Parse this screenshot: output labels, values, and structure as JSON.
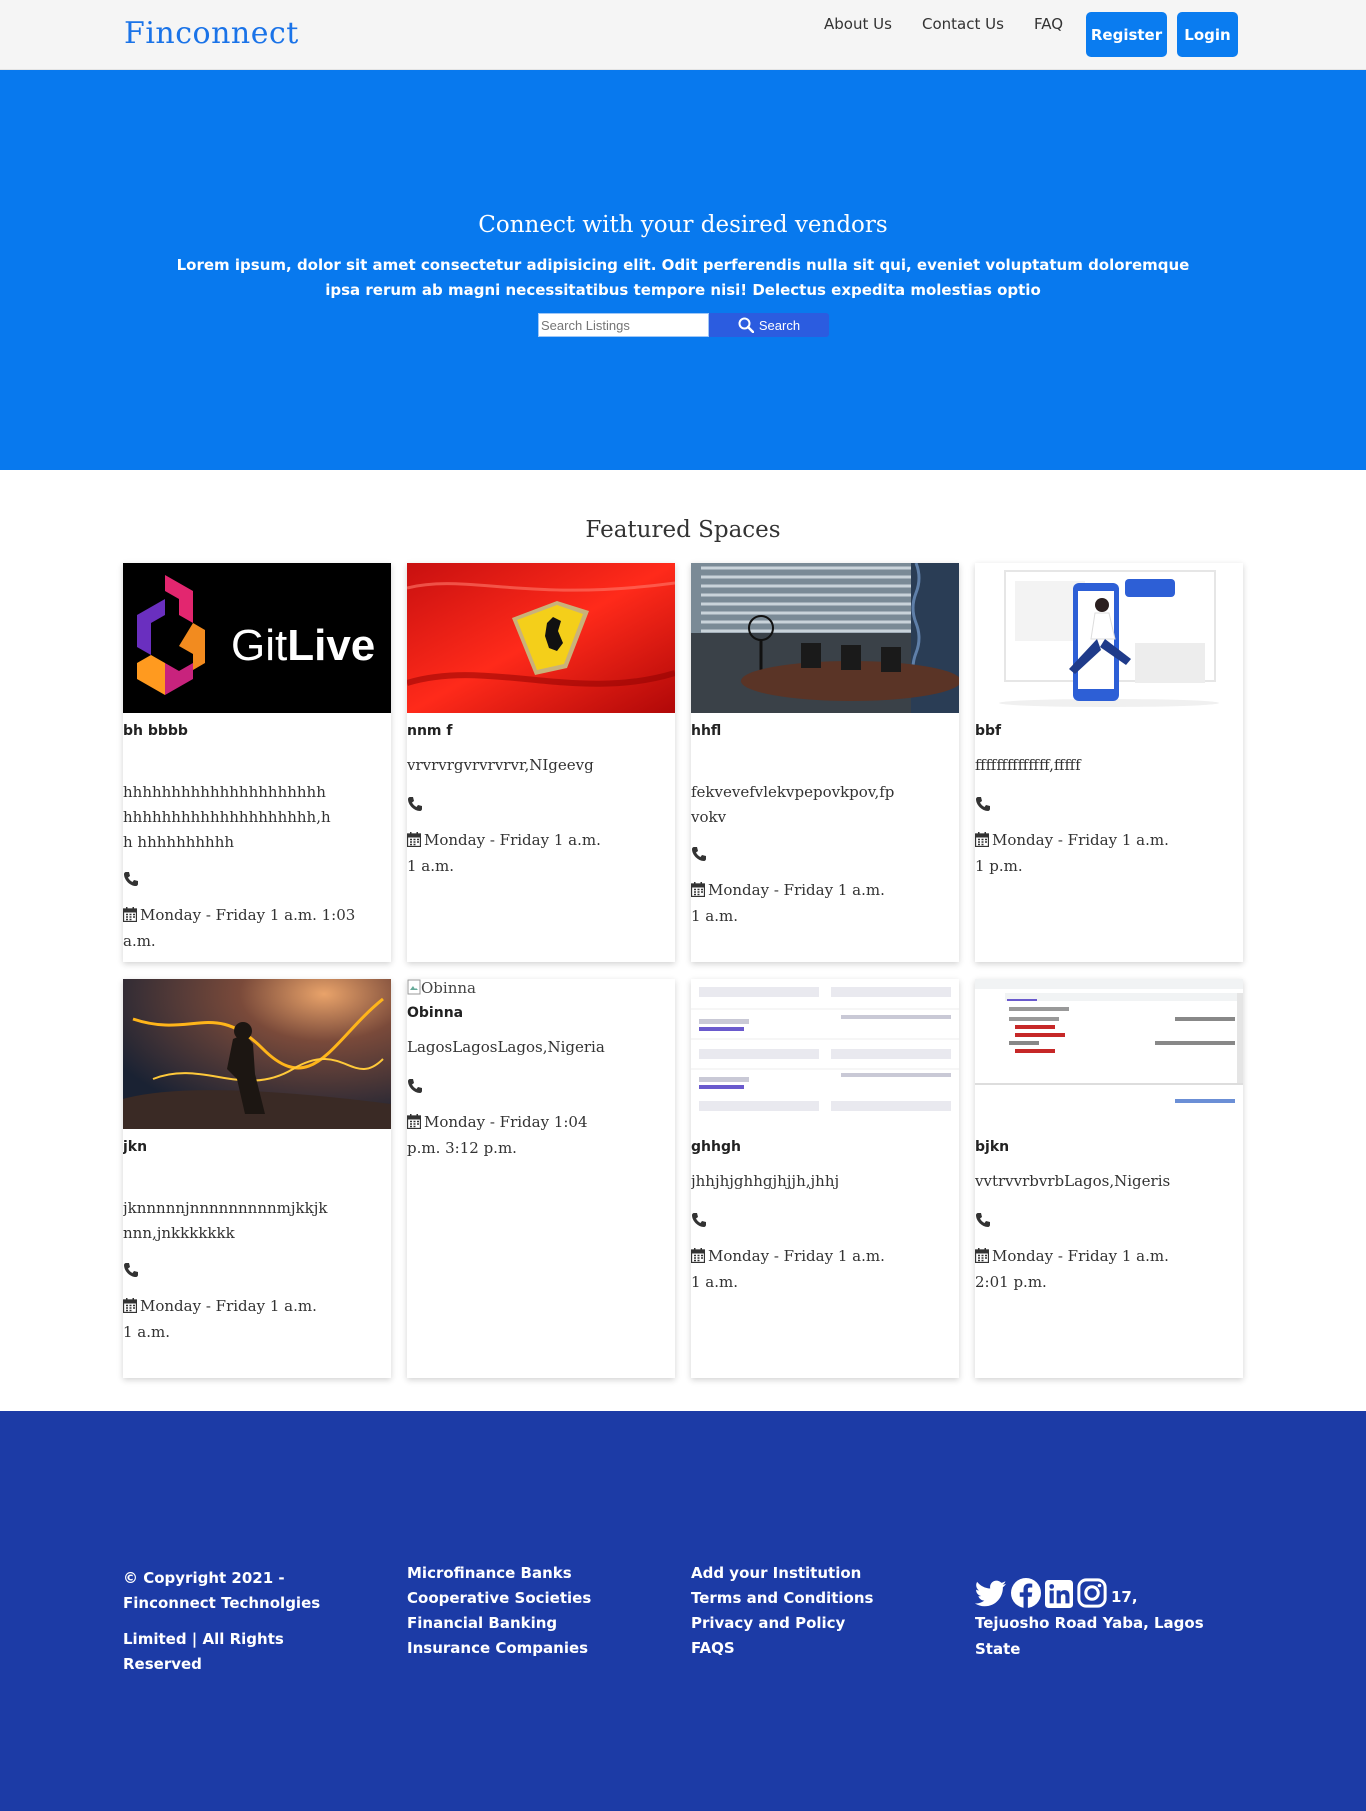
{
  "brand": "Finconnect",
  "nav": {
    "about": "About Us",
    "contact": "Contact Us",
    "faq": "FAQ",
    "register": "Register",
    "login": "Login"
  },
  "hero": {
    "title": "Connect with your desired vendors",
    "text": "Lorem ipsum, dolor sit amet consectetur adipisicing elit. Odit perferendis nulla sit qui, eveniet voluptatum doloremque ipsa rerum ab magni necessitatibus tempore nisi! Delectus expedita molestias optio",
    "search_placeholder": "Search Listings",
    "search_label": "Search"
  },
  "featured": {
    "title": "Featured Spaces",
    "cards": [
      {
        "title": "bh bbbb",
        "address": "hhhhhhhhhhhhhhhhhhhhh hhhhhhhhhhhhhhhhhhhh,hh hhhhhhhhhh",
        "hours": "Monday - Friday 1 a.m. 1:03 a.m.",
        "image": "gitlive"
      },
      {
        "title": "nnm f",
        "address": "vrvrvrgvrvrvrvr,NIgeevg",
        "hours": "Monday - Friday 1 a.m. 1 a.m.",
        "image": "ferrari"
      },
      {
        "title": "hhfl",
        "address": "fekvevefvlekvpepovkpov,fp vokv",
        "hours": "Monday - Friday 1 a.m. 1 a.m.",
        "image": "office"
      },
      {
        "title": "bbf",
        "address": "ffffffffffffff,fffff",
        "hours": "Monday - Friday 1 a.m. 1 p.m.",
        "image": "phone-illustration"
      },
      {
        "title": "jkn",
        "address": "jknnnnnjnnnnnnnnnmjkkjk nnn,jnkkkkkkk",
        "hours": "Monday - Friday 1 a.m. 1 a.m.",
        "image": "sparks"
      },
      {
        "title": "Obinna",
        "address": "LagosLagosLagos,Nigeria",
        "hours": "Monday - Friday 1:04 p.m. 3:12 p.m.",
        "image": "broken",
        "alt": "Obinna"
      },
      {
        "title": "ghhgh",
        "address": "jhhjhjghhgjhjjh,jhhj",
        "hours": "Monday - Friday 1 a.m. 1 a.m.",
        "image": "form-screenshot"
      },
      {
        "title": "bjkn",
        "address": "vvtrvvrbvrbLagos,Nigeris",
        "hours": "Monday - Friday 1 a.m. 2:01 p.m.",
        "image": "devtools-screenshot"
      }
    ]
  },
  "footer": {
    "copyright_line1": "© Copyright 2021 - Finconnect Technolgies",
    "copyright_line2": "Limited | All Rights Reserved",
    "col2": [
      "Microfinance Banks",
      "Cooperative Societies",
      "Financial Banking",
      "Insurance Companies"
    ],
    "col3": [
      "Add your Institution",
      "Terms and Conditions",
      "Privacy and Policy",
      "FAQS"
    ],
    "social_icons": [
      "twitter-icon",
      "facebook-icon",
      "linkedin-icon",
      "instagram-icon"
    ],
    "address": "17, Tejuosho Road Yaba, Lagos State"
  },
  "colors": {
    "primary": "#0879ee",
    "footer": "#1c3ba6",
    "button": "#0a7cf0",
    "logo": "#1a73e8"
  }
}
